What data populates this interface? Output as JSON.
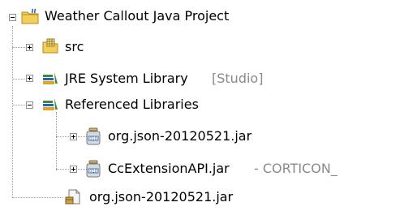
{
  "tree": {
    "project": {
      "label": "Weather Callout Java Project",
      "icon": "java-project-icon",
      "expanded": true
    },
    "items": [
      {
        "label": "src",
        "icon": "source-package-icon",
        "expanded": false
      },
      {
        "label": "JRE System Library",
        "decoration": "[Studio]",
        "icon": "library-icon",
        "expanded": false
      },
      {
        "label": "Referenced Libraries",
        "icon": "library-icon",
        "expanded": true
      },
      {
        "label": "org.json-20120521.jar",
        "icon": "jar-icon",
        "expanded": false
      },
      {
        "label": "CcExtensionAPI.jar",
        "decoration": "- CORTICON_",
        "icon": "jar-icon",
        "expanded": false
      },
      {
        "label": "org.json-20120521.jar",
        "icon": "jar-file-icon"
      }
    ]
  },
  "colors": {
    "folder": "#f2cf5b",
    "library_bar_1": "#3a8c3f",
    "library_bar_2": "#2b62b3",
    "library_bar_3": "#e0a526",
    "decoration": "#8a8a8a",
    "connector": "#9a9a9a"
  }
}
